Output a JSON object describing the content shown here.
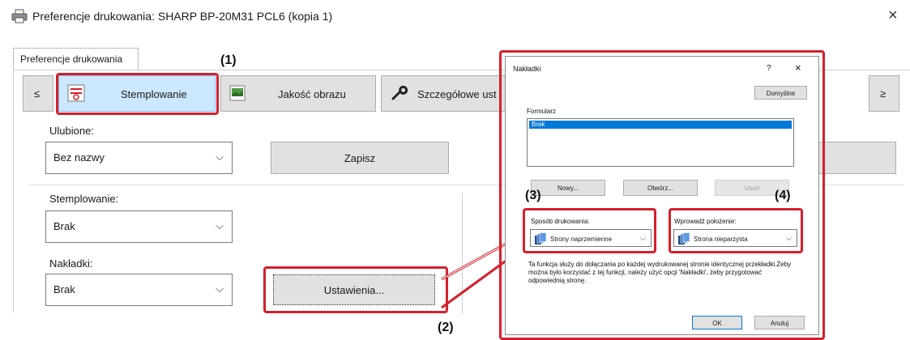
{
  "window": {
    "title": "Preferencje drukowania: SHARP BP-20M31 PCL6 (kopia 1)",
    "close": "×"
  },
  "tabs": [
    "Preferencje drukowania"
  ],
  "nav": {
    "prev": "≤",
    "next": "≥",
    "items": [
      "Stemplowanie",
      "Jakość obrazu",
      "Szczegółowe ust"
    ]
  },
  "favorites": {
    "label": "Ulubione:",
    "value": "Bez nazwy",
    "save": "Zapisz"
  },
  "stamp": {
    "label": "Stemplowanie:",
    "value": "Brak"
  },
  "overlays": {
    "label": "Nakładki:",
    "value": "Brak",
    "settings": "Ustawienia..."
  },
  "callouts": [
    "(1)",
    "(2)",
    "(3)",
    "(4)"
  ],
  "dialog": {
    "title": "Nakładki",
    "help": "?",
    "close": "×",
    "defaults": "Domyślne",
    "form_label": "Formularz",
    "form_items": [
      "Brak"
    ],
    "new": "Nowy...",
    "open": "Otwórz...",
    "delete": "Usuń",
    "print_method_label": "Sposób drukowania:",
    "print_method_value": "Strony naprzemienne",
    "position_label": "Wprowadź położenie:",
    "position_value": "Strona nieparzysta",
    "info": "Ta funkcja służy do dołączania po każdej wydrukowanej stronie identycznej przekładki.Żeby można było korzystać z tej funkcji, należy użyć opcji 'Nakładki', żeby przygotować odpowiednią stronę.",
    "ok": "OK",
    "cancel": "Anuluj"
  },
  "colors": {
    "highlight": "#d4202c",
    "selected_nav": "#cce8ff",
    "list_selection": "#0078d7"
  }
}
